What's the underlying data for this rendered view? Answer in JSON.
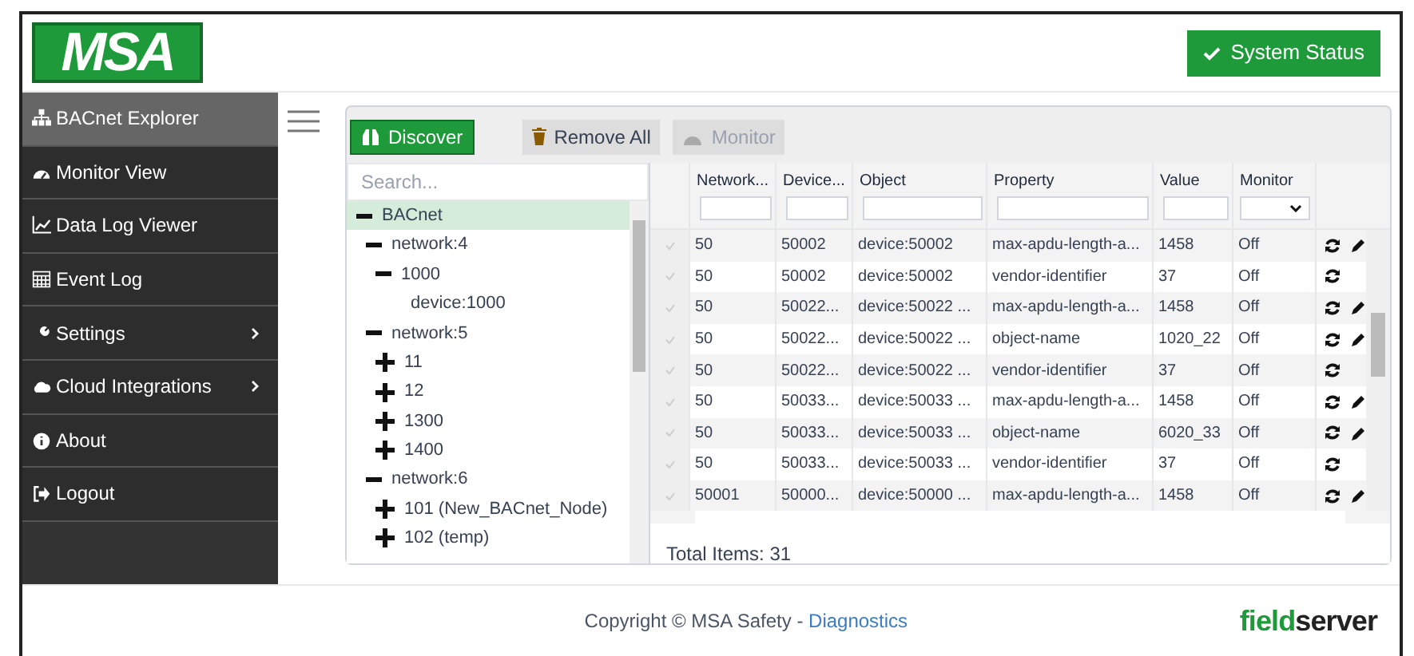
{
  "header": {
    "logo": "MSA",
    "status_button": "System Status"
  },
  "sidebar": {
    "items": [
      {
        "label": "BACnet Explorer",
        "selected": true,
        "submenu": false
      },
      {
        "label": "Monitor View",
        "selected": false,
        "submenu": false
      },
      {
        "label": "Data Log Viewer",
        "selected": false,
        "submenu": false
      },
      {
        "label": "Event Log",
        "selected": false,
        "submenu": false
      },
      {
        "label": "Settings",
        "selected": false,
        "submenu": true
      },
      {
        "label": "Cloud Integrations",
        "selected": false,
        "submenu": true
      },
      {
        "label": "About",
        "selected": false,
        "submenu": false
      },
      {
        "label": "Logout",
        "selected": false,
        "submenu": false
      }
    ]
  },
  "toolbar": [
    {
      "label": "Discover",
      "kind": "primary",
      "disabled": false
    },
    {
      "label": "Remove All",
      "kind": "secondary",
      "disabled": false
    },
    {
      "label": "Monitor",
      "kind": "secondary",
      "disabled": true
    }
  ],
  "tree": {
    "search_placeholder": "Search...",
    "nodes": [
      {
        "label": "BACnet",
        "expanded": true,
        "selected": true,
        "children": [
          {
            "label": "network:4",
            "expanded": true,
            "selected": false,
            "children": [
              {
                "label": "1000",
                "expanded": true,
                "selected": false,
                "children": [
                  {
                    "label": "device:1000",
                    "selected": false
                  }
                ]
              }
            ]
          },
          {
            "label": "network:5",
            "expanded": true,
            "selected": false,
            "children": [
              {
                "label": "11",
                "expanded": false,
                "selected": false
              },
              {
                "label": "12",
                "expanded": false,
                "selected": false
              },
              {
                "label": "1300",
                "expanded": false,
                "selected": false
              },
              {
                "label": "1400",
                "expanded": false,
                "selected": false
              }
            ]
          },
          {
            "label": "network:6",
            "expanded": true,
            "selected": false,
            "children": [
              {
                "label": "101 (New_BACnet_Node)",
                "expanded": false,
                "selected": false
              },
              {
                "label": "102 (temp)",
                "expanded": false,
                "selected": false
              }
            ]
          }
        ]
      }
    ]
  },
  "table": {
    "columns": [
      {
        "label": "Network...",
        "kind": "text"
      },
      {
        "label": "Device...",
        "kind": "text"
      },
      {
        "label": "Object",
        "kind": "text"
      },
      {
        "label": "Property",
        "kind": "text"
      },
      {
        "label": "Value",
        "kind": "text"
      },
      {
        "label": "Monitor",
        "kind": "select"
      }
    ],
    "rows": [
      {
        "cells": [
          "50",
          "50002",
          "device:50002",
          "max-apdu-length-a...",
          "1458",
          "Off"
        ],
        "editable": true
      },
      {
        "cells": [
          "50",
          "50002",
          "device:50002",
          "vendor-identifier",
          "37",
          "Off"
        ],
        "editable": false
      },
      {
        "cells": [
          "50",
          "50022...",
          "device:50022 ...",
          "max-apdu-length-a...",
          "1458",
          "Off"
        ],
        "editable": true
      },
      {
        "cells": [
          "50",
          "50022...",
          "device:50022 ...",
          "object-name",
          "1020_22",
          "Off"
        ],
        "editable": true
      },
      {
        "cells": [
          "50",
          "50022...",
          "device:50022 ...",
          "vendor-identifier",
          "37",
          "Off"
        ],
        "editable": false
      },
      {
        "cells": [
          "50",
          "50033...",
          "device:50033 ...",
          "max-apdu-length-a...",
          "1458",
          "Off"
        ],
        "editable": true
      },
      {
        "cells": [
          "50",
          "50033...",
          "device:50033 ...",
          "object-name",
          "6020_33",
          "Off"
        ],
        "editable": true
      },
      {
        "cells": [
          "50",
          "50033...",
          "device:50033 ...",
          "vendor-identifier",
          "37",
          "Off"
        ],
        "editable": false
      },
      {
        "cells": [
          "50001",
          "50000...",
          "device:50000 ...",
          "max-apdu-length-a...",
          "1458",
          "Off"
        ],
        "editable": true
      }
    ],
    "total": "Total Items: 31"
  },
  "footer": {
    "copyright": "Copyright © MSA Safety - ",
    "link": "Diagnostics",
    "brand_part_1": "field",
    "brand_part_2": "server"
  }
}
